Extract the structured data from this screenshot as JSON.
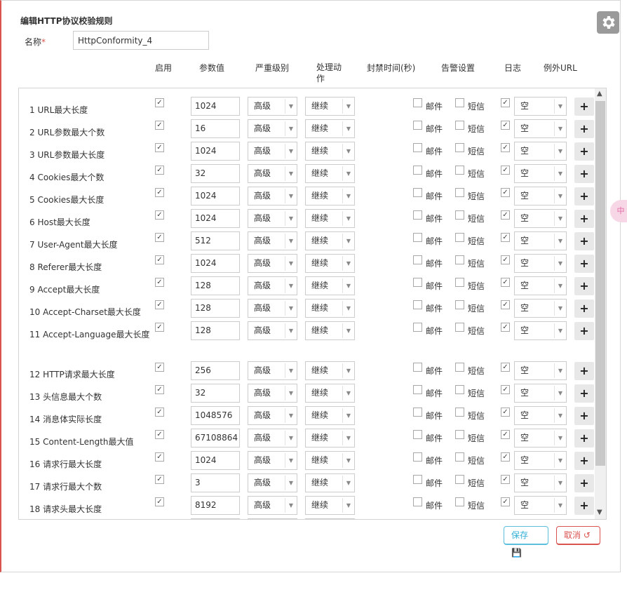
{
  "dialog": {
    "title": "编辑HTTP协议校验规则"
  },
  "form": {
    "name_label": "名称",
    "required_mark": "*",
    "name_value": "HttpConformity_4"
  },
  "headers": {
    "enable": "启用",
    "param": "参数值",
    "severity": "严重级别",
    "action_1": "处理动",
    "action_2": "作",
    "ban": "封禁时间(秒)",
    "alert": "告警设置",
    "log": "日志",
    "exception": "例外URL"
  },
  "labels": {
    "mail": "邮件",
    "sms": "短信"
  },
  "rows": [
    {
      "name": "1  URL最大长度",
      "value": "1024",
      "severity": "高级",
      "action": "继续",
      "log_url": "空"
    },
    {
      "name": "2  URL参数最大个数",
      "value": "16",
      "severity": "高级",
      "action": "继续",
      "log_url": "空"
    },
    {
      "name": "3  URL参数最大长度",
      "value": "1024",
      "severity": "高级",
      "action": "继续",
      "log_url": "空"
    },
    {
      "name": "4  Cookies最大个数",
      "value": "32",
      "severity": "高级",
      "action": "继续",
      "log_url": "空"
    },
    {
      "name": "5  Cookies最大长度",
      "value": "1024",
      "severity": "高级",
      "action": "继续",
      "log_url": "空"
    },
    {
      "name": "6  Host最大长度",
      "value": "1024",
      "severity": "高级",
      "action": "继续",
      "log_url": "空"
    },
    {
      "name": "7  User-Agent最大长度",
      "value": "512",
      "severity": "高级",
      "action": "继续",
      "log_url": "空"
    },
    {
      "name": "8  Referer最大长度",
      "value": "1024",
      "severity": "高级",
      "action": "继续",
      "log_url": "空"
    },
    {
      "name": "9  Accept最大长度",
      "value": "128",
      "severity": "高级",
      "action": "继续",
      "log_url": "空"
    },
    {
      "name": "10  Accept-Charset最大长度",
      "value": "128",
      "severity": "高级",
      "action": "继续",
      "log_url": "空"
    },
    {
      "name": "11  Accept-Language最大长度",
      "value": "128",
      "severity": "高级",
      "action": "继续",
      "log_url": "空"
    },
    {
      "name": "12  HTTP请求最大长度",
      "value": "256",
      "severity": "高级",
      "action": "继续",
      "log_url": "空"
    },
    {
      "name": "13  头信息最大个数",
      "value": "32",
      "severity": "高级",
      "action": "继续",
      "log_url": "空"
    },
    {
      "name": "14  消息体实际长度",
      "value": "1048576",
      "severity": "高级",
      "action": "继续",
      "log_url": "空"
    },
    {
      "name": "15  Content-Length最大值",
      "value": "67108864",
      "severity": "高级",
      "action": "继续",
      "log_url": "空"
    },
    {
      "name": "16  请求行最大长度",
      "value": "1024",
      "severity": "高级",
      "action": "继续",
      "log_url": "空"
    },
    {
      "name": "17  请求行最大个数",
      "value": "3",
      "severity": "高级",
      "action": "继续",
      "log_url": "空"
    },
    {
      "name": "18  请求头最大长度",
      "value": "8192",
      "severity": "高级",
      "action": "继续",
      "log_url": "空"
    }
  ],
  "buttons": {
    "save": "保存",
    "cancel": "取消"
  },
  "icons": {
    "settings": "gear-icon",
    "save": "floppy-icon",
    "cancel": "undo-icon",
    "add": "plus-icon"
  },
  "side_tab": "中",
  "colors": {
    "danger": "#d9534f",
    "info": "#5bc0de"
  }
}
